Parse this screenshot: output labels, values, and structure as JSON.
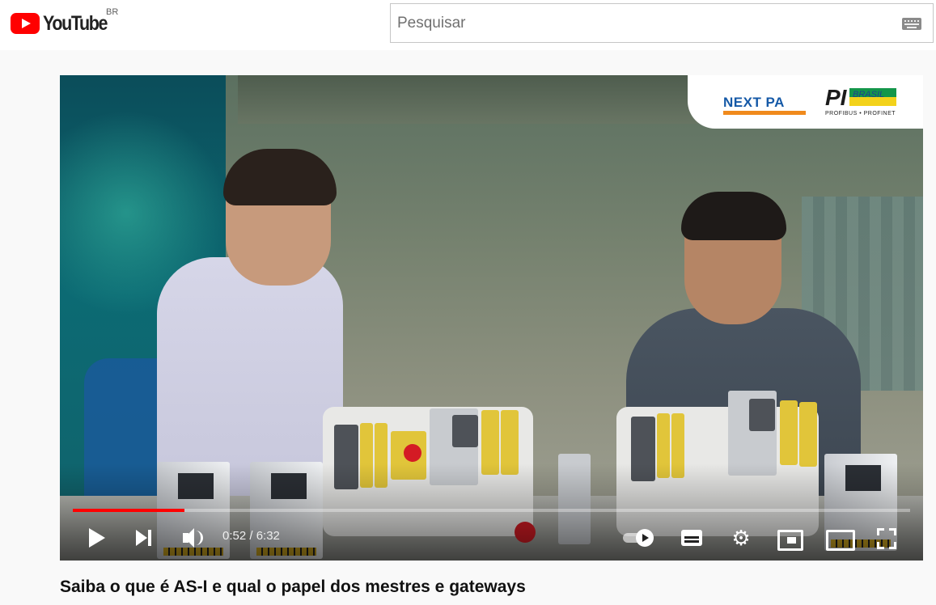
{
  "header": {
    "logo_text": "YouTube",
    "country_code": "BR",
    "search_placeholder": "Pesquisar",
    "icons": {
      "keyboard": "keyboard-icon"
    }
  },
  "player": {
    "sponsors": {
      "next_pa": "NEXT PA",
      "pi": "PI",
      "pi_brasil": "BRASIL",
      "pi_sub": "PROFIBUS • PROFINET"
    },
    "progress": 0.133,
    "time_display": "0:52 / 6:32",
    "colors": {
      "progress": "#ff0000"
    },
    "icons": {
      "play": "play-icon",
      "next": "next-icon",
      "volume": "volume-icon",
      "autoplay": "autoplay-toggle",
      "subtitles": "cc-icon",
      "settings": "gear-icon",
      "miniplayer": "miniplayer-icon",
      "theater": "theater-icon",
      "fullscreen": "fullscreen-icon"
    }
  },
  "video": {
    "title": "Saiba o que é AS-I e qual o papel dos mestres e gateways"
  },
  "brand": {
    "red": "#ff0000"
  }
}
